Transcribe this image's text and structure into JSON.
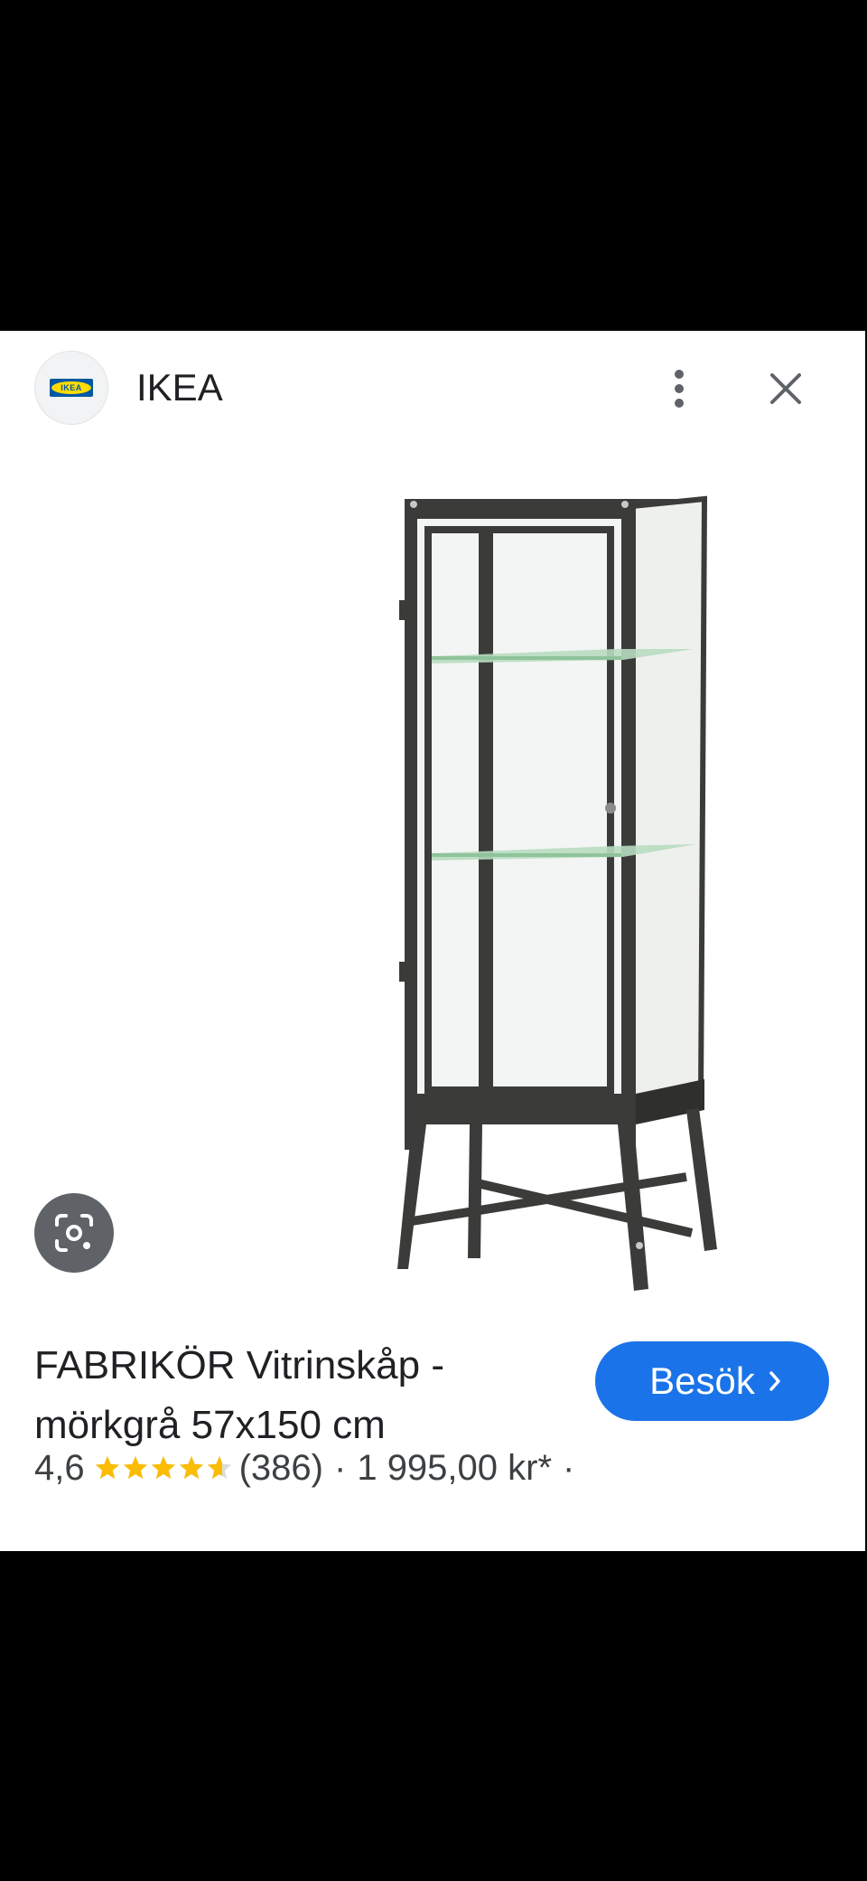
{
  "header": {
    "site_name": "IKEA",
    "favicon_text": "IKEA"
  },
  "product": {
    "title": "FABRIKÖR Vitrinskåp - mörkgrå 57x150 cm",
    "rating": "4,6",
    "rating_value": 4.6,
    "review_count": "(386)",
    "separator": "·",
    "price": "1 995,00 kr*",
    "trailing_separator": "·"
  },
  "actions": {
    "visit_label": "Besök"
  },
  "icons": {
    "more": "more-vert-icon",
    "close": "close-icon",
    "lens": "google-lens-icon",
    "chevron": "chevron-right-icon"
  },
  "colors": {
    "visit_button": "#1a73e8",
    "star": "#fbbc04",
    "lens_button": "#5f6368",
    "ikea_blue": "#0058a3",
    "ikea_yellow": "#ffdb00"
  }
}
